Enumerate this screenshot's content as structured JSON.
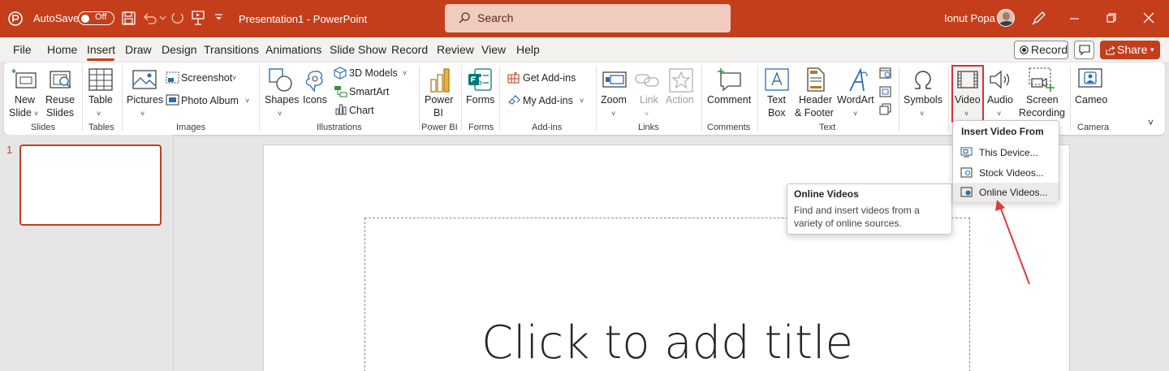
{
  "titlebar": {
    "autosave_label": "AutoSave",
    "autosave_state": "Off",
    "document_title": "Presentation1  -  PowerPoint",
    "search_placeholder": "Search",
    "user_name": "Ionut Popa",
    "accent_color": "#c43e1c"
  },
  "menu": {
    "items": [
      "File",
      "Home",
      "Insert",
      "Draw",
      "Design",
      "Transitions",
      "Animations",
      "Slide Show",
      "Record",
      "Review",
      "View",
      "Help"
    ],
    "active": "Insert",
    "record_button": "Record",
    "share_button": "Share"
  },
  "ribbon": {
    "groups": {
      "slides": "Slides",
      "tables": "Tables",
      "images": "Images",
      "illustrations": "Illustrations",
      "powerbi": "Power BI",
      "forms": "Forms",
      "addins": "Add-ins",
      "links": "Links",
      "comments": "Comments",
      "text": "Text",
      "camera": "Camera"
    },
    "new_slide": [
      "New",
      "Slide"
    ],
    "reuse_slides": [
      "Reuse",
      "Slides"
    ],
    "table": "Table",
    "pictures": "Pictures",
    "screenshot": "Screenshot",
    "photo_album": "Photo Album",
    "shapes": "Shapes",
    "icons": "Icons",
    "models_3d": "3D Models",
    "smartart": "SmartArt",
    "chart": "Chart",
    "power_bi": [
      "Power",
      "BI"
    ],
    "forms": "Forms",
    "get_addins": "Get Add-ins",
    "my_addins": "My Add-ins",
    "zoom": "Zoom",
    "link": "Link",
    "action": "Action",
    "comment": "Comment",
    "text_box": [
      "Text",
      "Box"
    ],
    "header_footer": [
      "Header",
      "& Footer"
    ],
    "wordart": "WordArt",
    "symbols": "Symbols",
    "video": "Video",
    "audio": "Audio",
    "screen_recording": [
      "Screen",
      "Recording"
    ],
    "cameo": "Cameo"
  },
  "slides_pane": {
    "slide_number": "1"
  },
  "slide": {
    "title_placeholder": "Click to add title"
  },
  "video_menu": {
    "header": "Insert Video From",
    "items": [
      "This Device...",
      "Stock Videos...",
      "Online Videos..."
    ],
    "hovered": "Online Videos..."
  },
  "tooltip": {
    "title": "Online Videos",
    "body_line1": "Find and insert videos from a",
    "body_line2": "variety of online sources."
  }
}
